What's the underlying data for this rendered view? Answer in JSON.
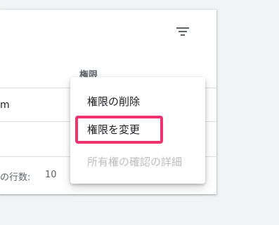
{
  "table": {
    "column_header": "権限",
    "row_text_fragment": "m",
    "footer": {
      "rows_per_page_label": "の行数:",
      "rows_per_page_value": "10"
    },
    "filter_icon": "filter-list-icon"
  },
  "context_menu": {
    "items": [
      {
        "label": "権限の削除",
        "enabled": true
      },
      {
        "label": "権限を変更",
        "enabled": true
      },
      {
        "label": "所有権の確認の詳細",
        "enabled": false
      }
    ]
  },
  "colors": {
    "highlight": "#f0336f",
    "disabled_text": "#bdbdbd",
    "header_text": "#5f6368"
  }
}
